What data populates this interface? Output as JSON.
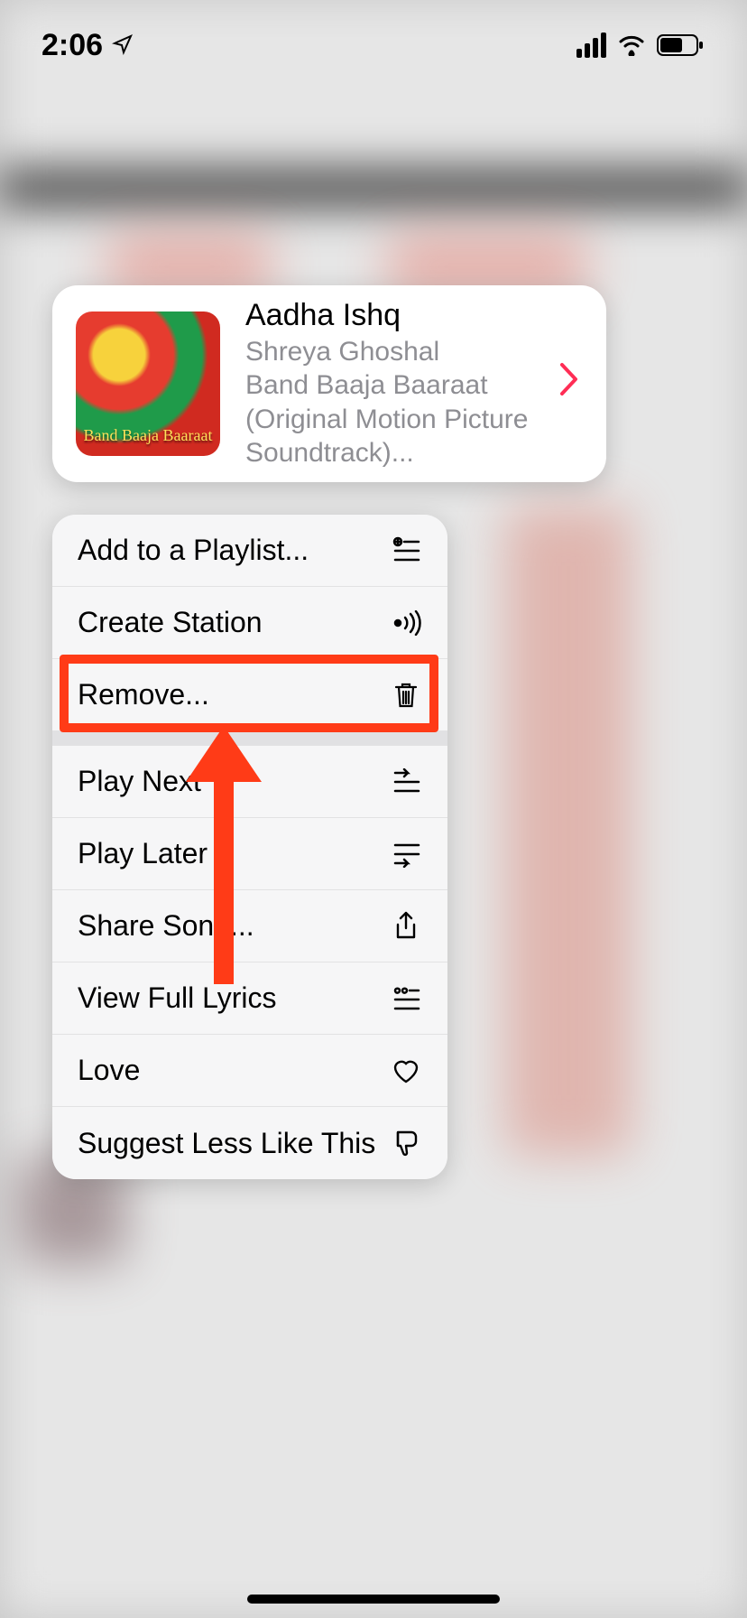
{
  "status": {
    "time": "2:06"
  },
  "song": {
    "title": "Aadha Ishq",
    "artist": "Shreya Ghoshal",
    "album": "Band Baaja Baaraat (Original Motion Picture Soundtrack)..."
  },
  "menu": {
    "add_to_playlist": "Add to a Playlist...",
    "create_station": "Create Station",
    "remove": "Remove...",
    "play_next": "Play Next",
    "play_later": "Play Later",
    "share_song": "Share Song...",
    "view_lyrics": "View Full Lyrics",
    "love": "Love",
    "suggest_less": "Suggest Less Like This"
  },
  "annotation": {
    "highlighted": "remove"
  }
}
